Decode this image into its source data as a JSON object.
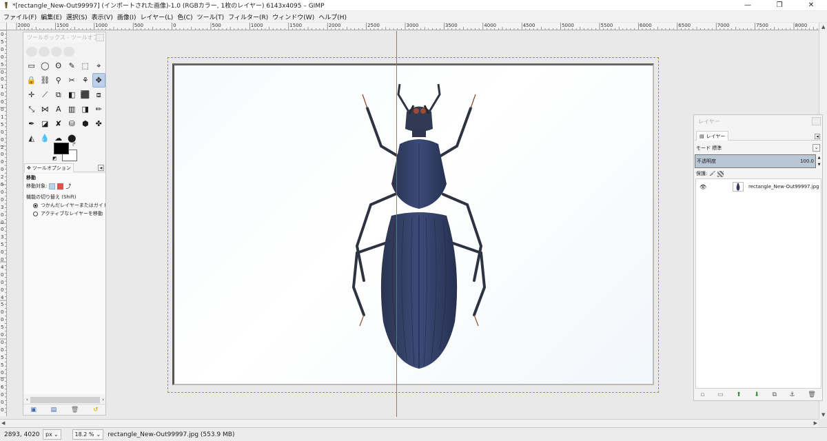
{
  "window": {
    "title": "*[rectangle_New-Out99997] (インポートされた画像)-1.0 (RGBカラー, 1枚のレイヤー) 6143x4095 – GIMP",
    "minimize": "—",
    "maximize": "❐",
    "close": "✕"
  },
  "menu": [
    "ファイル(F)",
    "編集(E)",
    "選択(S)",
    "表示(V)",
    "画像(I)",
    "レイヤー(L)",
    "色(C)",
    "ツール(T)",
    "フィルター(R)",
    "ウィンドウ(W)",
    "ヘルプ(H)"
  ],
  "ruler": {
    "top_labels": [
      "2000",
      "1500",
      "1000",
      "500",
      "0",
      "500",
      "1000",
      "1500",
      "2000",
      "2500",
      "3000",
      "3500",
      "4000",
      "4500",
      "5000",
      "5500",
      "6000",
      "6500",
      "7000",
      "7500",
      "8000"
    ],
    "left_labels": [
      "0",
      "5",
      "0",
      "0",
      "5",
      "0",
      "0",
      "1",
      "0",
      "0",
      "0",
      "1",
      "5",
      "0",
      "0",
      "2",
      "0",
      "0",
      "0",
      "2",
      "5",
      "0",
      "0",
      "3",
      "0",
      "0",
      "0",
      "3",
      "5",
      "0",
      "0",
      "4",
      "0",
      "0",
      "0",
      "4",
      "5",
      "0",
      "0",
      "5",
      "0",
      "0",
      "0",
      "5",
      "5",
      "0",
      "0",
      "6",
      "0",
      "0",
      "0"
    ]
  },
  "toolbox": {
    "title": "ツールボックス - ツールオプ...",
    "tools": [
      "▭",
      "◯",
      "ʘ",
      "✎",
      "⬚",
      "⌖",
      "🔒",
      "⛓",
      "⚲",
      "✂",
      "⚘",
      "✥",
      "✛",
      "⟋",
      "⧉",
      "◧",
      "⬛",
      "⧈",
      "⤡",
      "⋈",
      "A",
      "▥",
      "◨",
      "✏",
      "✒",
      "◪",
      "✘",
      "⛁",
      "⬢",
      "✤",
      "◭",
      "💧",
      "☁",
      "⬤"
    ],
    "tool_options_tab": "ツールオプション",
    "option_title": "移動",
    "move_target_label": "移動対象:",
    "toggle_label": "機能の切り替え (Shift)",
    "radio_1": "つかんだレイヤーまたはガイドを移動",
    "radio_2": "アクティブなレイヤーを移動",
    "colors": {
      "fg": "#000000",
      "bg": "#ffffff"
    }
  },
  "layers": {
    "title": "レイヤー",
    "tab": "レイヤー",
    "mode_label": "モード",
    "mode_value": "標準",
    "opacity_label": "不透明度",
    "opacity_value": "100.0",
    "lock_label": "保護:",
    "layer_name": "rectangle_New-Out99997.jpg"
  },
  "status": {
    "coords": "2893, 4020",
    "unit": "px",
    "zoom": "18.2 %",
    "file": "rectangle_New-Out99997.jpg (553.9 MB)"
  }
}
